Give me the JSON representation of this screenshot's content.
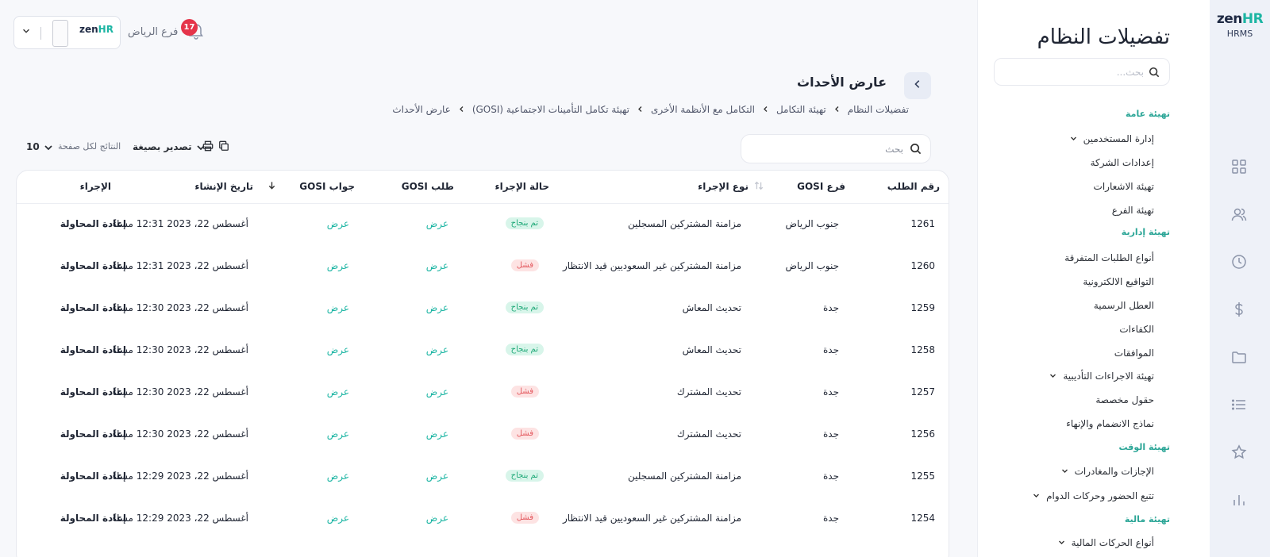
{
  "rail": {
    "logo_zen": "zen",
    "logo_hr": "HR",
    "logo_sub": "HRMS",
    "icons": [
      "grid-icon",
      "users-icon",
      "clock-icon",
      "dollar-icon",
      "folder-icon",
      "list-icon",
      "star-icon",
      "chart-icon"
    ]
  },
  "sidebar": {
    "title": "تفضيلات النظام",
    "search_placeholder": "بحث...",
    "items": [
      {
        "type": "section",
        "label": "تهيئة عامة"
      },
      {
        "type": "link",
        "label": "إدارة المستخدمين",
        "expand": true
      },
      {
        "type": "link",
        "label": "إعدادات الشركة"
      },
      {
        "type": "link",
        "label": "تهيئة الاشعارات"
      },
      {
        "type": "link",
        "label": "تهيئة الفرع"
      },
      {
        "type": "section",
        "label": "تهيئة إدارية"
      },
      {
        "type": "link",
        "label": "أنواع الطلبات المتفرقة"
      },
      {
        "type": "link",
        "label": "التواقيع الالكترونية"
      },
      {
        "type": "link",
        "label": "العطل الرسمية"
      },
      {
        "type": "link",
        "label": "الكفاءات"
      },
      {
        "type": "link",
        "label": "الموافقات"
      },
      {
        "type": "link",
        "label": "تهيئة الاجراءات التأديبية",
        "expand": true
      },
      {
        "type": "link",
        "label": "حقول مخصصة"
      },
      {
        "type": "link",
        "label": "نماذج الانضمام والإنهاء"
      },
      {
        "type": "section",
        "label": "تهيئة الوقت"
      },
      {
        "type": "link",
        "label": "الإجازات والمغادرات",
        "expand": true
      },
      {
        "type": "link",
        "label": "تتبع الحضور وحركات الدوام",
        "expand": true
      },
      {
        "type": "section",
        "label": "تهيئة مالية"
      },
      {
        "type": "link",
        "label": "أنواع الحركات المالية",
        "expand": true
      }
    ]
  },
  "topbar": {
    "branch": "فرع الرياض",
    "notifications": "17",
    "brand_zen": "zen",
    "brand_hr": "HR"
  },
  "page": {
    "title": "عارض الأحداث",
    "breadcrumb": [
      "تفضيلات النظام",
      "تهيئة التكامل",
      "التكامل مع الأنظمة الأخرى",
      "تهيئة تكامل التأمينات الاجتماعية (GOSI)",
      "عارض الأحداث"
    ]
  },
  "toolbar": {
    "search_placeholder": "بحث",
    "export_label": "تصدير بصيغة",
    "per_page_label": "النتائج لكل صفحة",
    "per_page_value": "10"
  },
  "table": {
    "headers": {
      "id": "رقم الطلب",
      "branch": "فرع GOSI",
      "type": "نوع الإجراء",
      "status": "حالة الإجراء",
      "request": "طلب GOSI",
      "response": "جواب GOSI",
      "created": "تاريخ الإنشاء",
      "action": "الإجراء"
    },
    "view_label": "عرض",
    "retry_label": "إعادة المحاولة",
    "rows": [
      {
        "id": "1261",
        "branch": "جنوب الرياض",
        "type": "مزامنة المشتركين المسجلين",
        "status": "ok",
        "status_label": "تم بنجاح",
        "created": "أغسطس 22، 2023 12:31 مساءً"
      },
      {
        "id": "1260",
        "branch": "جنوب الرياض",
        "type": "مزامنة المشتركين غير السعوديين قيد الانتظار",
        "status": "fail",
        "status_label": "فشل",
        "created": "أغسطس 22، 2023 12:31 مساءً"
      },
      {
        "id": "1259",
        "branch": "جدة",
        "type": "تحديث المعاش",
        "status": "ok",
        "status_label": "تم بنجاح",
        "created": "أغسطس 22، 2023 12:30 مساءً"
      },
      {
        "id": "1258",
        "branch": "جدة",
        "type": "تحديث المعاش",
        "status": "ok",
        "status_label": "تم بنجاح",
        "created": "أغسطس 22، 2023 12:30 مساءً"
      },
      {
        "id": "1257",
        "branch": "جدة",
        "type": "تحديث المشترك",
        "status": "fail",
        "status_label": "فشل",
        "created": "أغسطس 22، 2023 12:30 مساءً"
      },
      {
        "id": "1256",
        "branch": "جدة",
        "type": "تحديث المشترك",
        "status": "fail",
        "status_label": "فشل",
        "created": "أغسطس 22، 2023 12:30 مساءً"
      },
      {
        "id": "1255",
        "branch": "جدة",
        "type": "مزامنة المشتركين المسجلين",
        "status": "ok",
        "status_label": "تم بنجاح",
        "created": "أغسطس 22، 2023 12:29 مساءً"
      },
      {
        "id": "1254",
        "branch": "جدة",
        "type": "مزامنة المشتركين غير السعوديين قيد الانتظار",
        "status": "fail",
        "status_label": "فشل",
        "created": "أغسطس 22، 2023 12:29 مساءً"
      }
    ]
  }
}
